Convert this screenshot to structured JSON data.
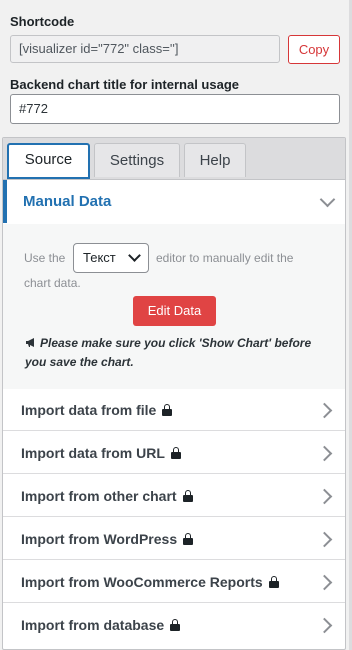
{
  "shortcode": {
    "label": "Shortcode",
    "value": "[visualizer id=\"772\" class='']",
    "copy_label": "Copy"
  },
  "backend_title": {
    "label": "Backend chart title for internal usage",
    "value": "#772"
  },
  "tabs": [
    {
      "label": "Source",
      "active": true
    },
    {
      "label": "Settings",
      "active": false
    },
    {
      "label": "Help",
      "active": false
    }
  ],
  "manual": {
    "title": "Manual Data",
    "text_before": "Use the",
    "editor_option": "Текст",
    "text_after": "editor to manually edit the",
    "text_line2": "chart data.",
    "edit_label": "Edit Data",
    "note": "Please make sure you click 'Show Chart' before you save the chart."
  },
  "imports": [
    {
      "label": "Import data from file",
      "locked": true
    },
    {
      "label": "Import data from URL",
      "locked": true
    },
    {
      "label": "Import from other chart",
      "locked": true
    },
    {
      "label": "Import from WordPress",
      "locked": true
    },
    {
      "label": "Import from WooCommerce Reports",
      "locked": true
    },
    {
      "label": "Import from database",
      "locked": true
    }
  ],
  "colors": {
    "accent": "#2271b1",
    "danger": "#e04444"
  }
}
